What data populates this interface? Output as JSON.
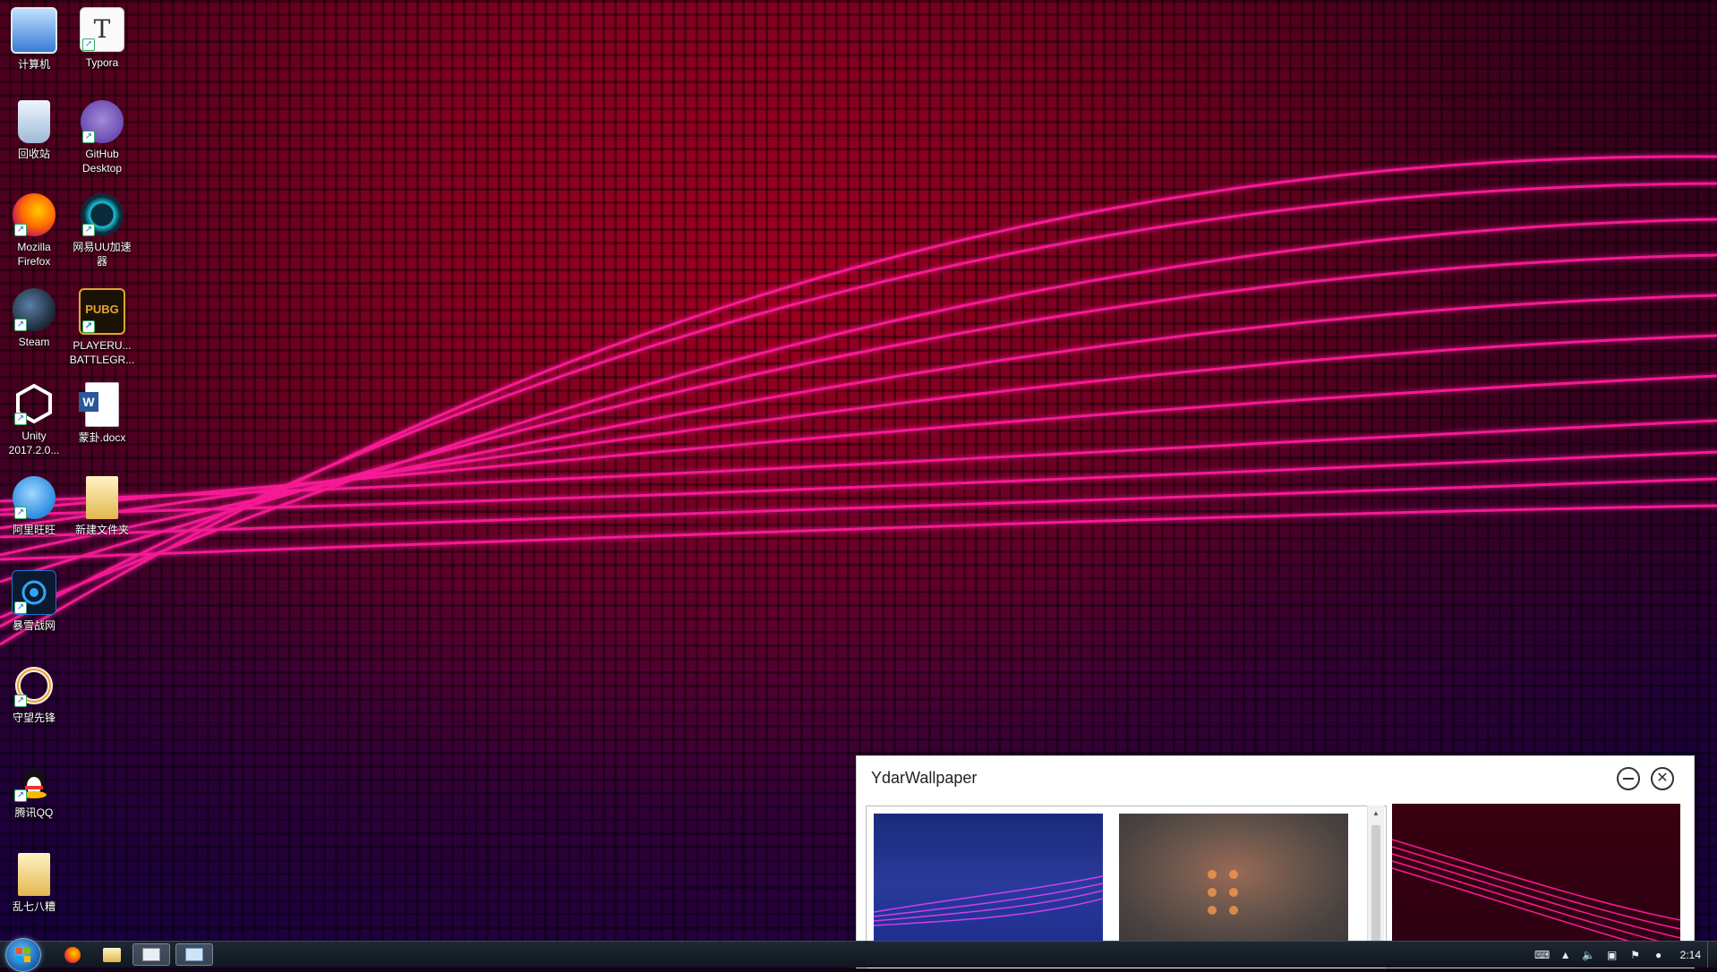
{
  "desktop": {
    "icons": [
      {
        "label": "计算机"
      },
      {
        "label": "Typora"
      },
      {
        "label": "回收站"
      },
      {
        "label": "GitHub\nDesktop"
      },
      {
        "label": "Mozilla\nFirefox"
      },
      {
        "label": "网易UU加速\n器"
      },
      {
        "label": "Steam"
      },
      {
        "label": "PLAYERU...\nBATTLEGR..."
      },
      {
        "label": "Unity\n2017.2.0..."
      },
      {
        "label": "蒙卦.docx"
      },
      {
        "label": "阿里旺旺"
      },
      {
        "label": "新建文件夹"
      },
      {
        "label": "暴雪战网"
      },
      {
        "label": "守望先锋"
      },
      {
        "label": "腾讯QQ"
      },
      {
        "label": "乱七八糟"
      }
    ]
  },
  "window": {
    "title": "YdarWallpaper",
    "minimize_icon": "minimize-icon",
    "close_icon": "close-icon"
  },
  "taskbar": {
    "start_icon": "windows-start-icon",
    "items": [
      "firefox-icon",
      "file-explorer-icon",
      "remote-desktop-icon",
      "ydarwallpaper-app-icon"
    ],
    "tray": {
      "clock": "2:14"
    }
  }
}
